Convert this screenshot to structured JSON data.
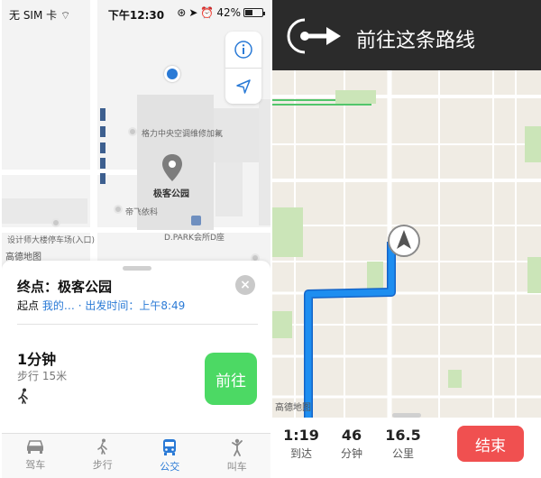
{
  "left": {
    "status": {
      "carrier": "无 SIM 卡",
      "time": "下午12:30",
      "battery": "42%"
    },
    "map": {
      "labels": {
        "geli": "格力中央空调维修加氟",
        "park": "极客公园",
        "difei": "帝飞依科",
        "dpark": "D.PARK会所D座",
        "parking": "设计师大楼停车场(入口)"
      },
      "logo": "高德地图"
    },
    "sheet": {
      "dest_title": "终点：极客公园",
      "origin_label": "起点",
      "origin_value": "我的…",
      "depart_text": "· 出发时间：",
      "depart_time": "上午8:49",
      "close_glyph": "×",
      "duration": "1分钟",
      "walk_distance": "步行 15米",
      "go_label": "前往"
    },
    "tabs": [
      {
        "label": "驾车",
        "icon": "car-icon"
      },
      {
        "label": "步行",
        "icon": "walk-icon"
      },
      {
        "label": "公交",
        "icon": "bus-icon"
      },
      {
        "label": "叫车",
        "icon": "hail-icon"
      }
    ],
    "colors": {
      "accent": "#2a7ad6",
      "go": "#4cd964"
    }
  },
  "right": {
    "header_text": "前往这条路线",
    "logo": "高德地图",
    "stats": [
      {
        "value": "1:19",
        "label": "到达"
      },
      {
        "value": "46",
        "label": "分钟"
      },
      {
        "value": "16.5",
        "label": "公里"
      }
    ],
    "end_label": "结束",
    "colors": {
      "route": "#1e8ef0",
      "end": "#f05050"
    }
  }
}
